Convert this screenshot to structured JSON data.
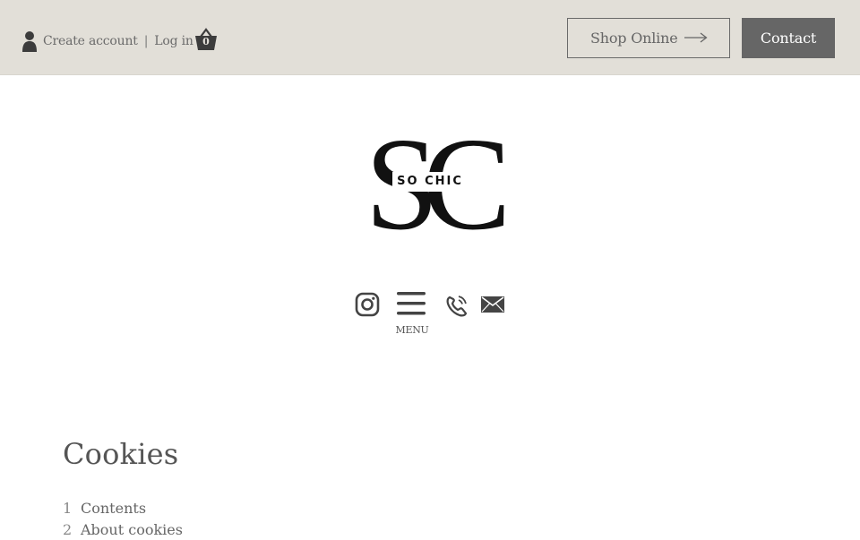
{
  "header": {
    "create_account": "Create account",
    "separator": "|",
    "login": "Log in",
    "cart_count": "0",
    "shop_online": "Shop Online",
    "contact": "Contact"
  },
  "logo": {
    "letters": "SC",
    "tagline": "SO CHIC"
  },
  "social": {
    "menu_label": "MENU",
    "icons": [
      "instagram-icon",
      "hamburger-menu-icon",
      "phone-icon",
      "mail-icon"
    ]
  },
  "content": {
    "heading": "Cookies",
    "toc": [
      {
        "num": "1",
        "label": "Contents"
      },
      {
        "num": "2",
        "label": "About cookies"
      }
    ]
  },
  "colors": {
    "topbar": "#e2dfd8",
    "contact_bg": "#666666",
    "text": "#555555",
    "logo": "#111111"
  }
}
